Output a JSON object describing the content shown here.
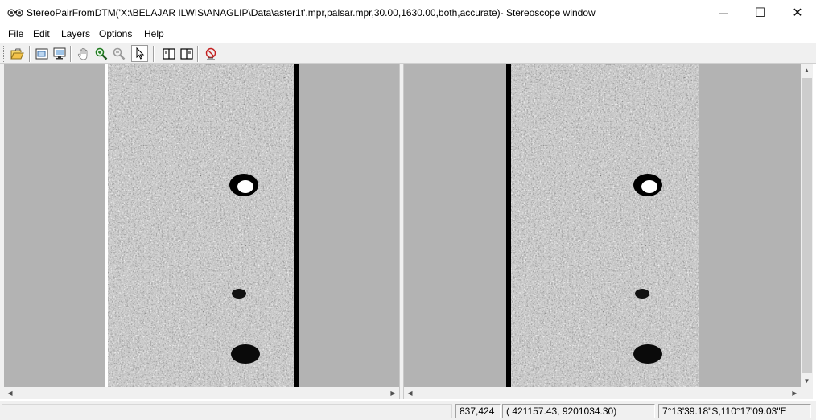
{
  "window": {
    "title": "StereoPairFromDTM('X:\\BELAJAR ILWIS\\ANAGLIP\\Data\\aster1t'.mpr,palsar.mpr,30.00,1630.00,both,accurate)- Stereoscope window",
    "minimize_glyph": "—",
    "maximize_glyph": "☐",
    "close_glyph": "✕"
  },
  "menu": {
    "items": [
      "File",
      "Edit",
      "Layers",
      "Options",
      "Help"
    ]
  },
  "toolbar": {
    "icons": [
      "open-folder-icon",
      "entire-map-icon",
      "normal-view-icon",
      "pan-hand-icon",
      "zoom-in-icon",
      "zoom-out-icon",
      "select-pointer-icon",
      "left-pane-icon",
      "right-pane-icon",
      "stereo-pair-icon"
    ]
  },
  "scrollbars": {
    "left_arrow": "◀",
    "right_arrow": "▶",
    "up_arrow": "▲",
    "down_arrow": "▼"
  },
  "status": {
    "rowcol": "837,424",
    "coords": "(   421157.43,  9201034.30)",
    "latlon": "7°13'39.18\"S,110°17'09.03\"E"
  }
}
